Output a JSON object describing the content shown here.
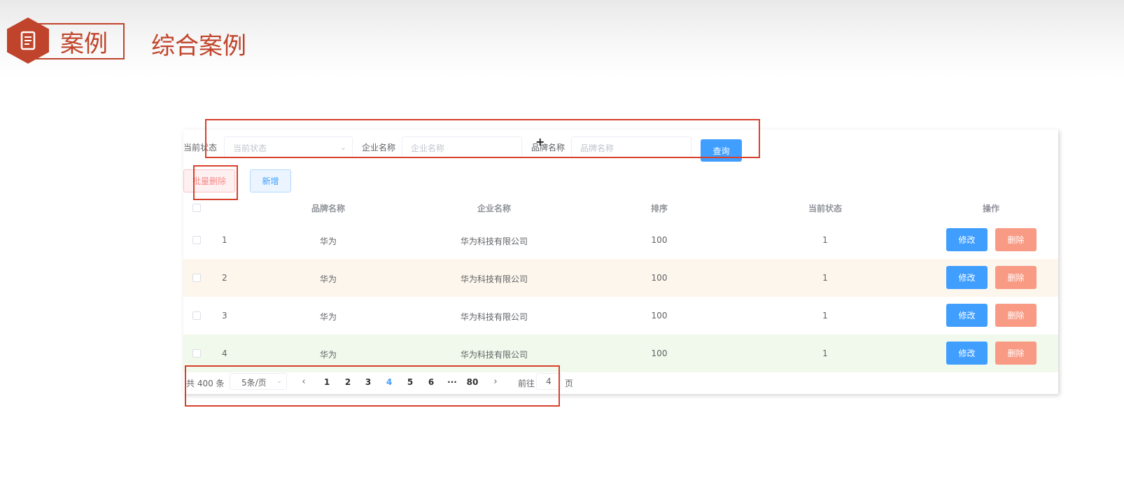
{
  "slide": {
    "badge": "案例",
    "subtitle": "综合案例",
    "accent_color": "#c0442b",
    "icon": "document-icon"
  },
  "search": {
    "status_label": "当前状态",
    "status_placeholder": "当前状态",
    "company_label": "企业名称",
    "company_placeholder": "企业名称",
    "brand_label": "品牌名称",
    "brand_placeholder": "品牌名称",
    "query_button": "查询"
  },
  "actions": {
    "batch_delete": "批量删除",
    "add": "新增"
  },
  "table": {
    "headers": {
      "brand": "品牌名称",
      "company": "企业名称",
      "order": "排序",
      "status": "当前状态",
      "ops": "操作"
    },
    "edit_label": "修改",
    "delete_label": "删除",
    "rows": [
      {
        "index": "1",
        "brand": "华为",
        "company": "华为科技有限公司",
        "order": "100",
        "status": "1",
        "highlight": ""
      },
      {
        "index": "2",
        "brand": "华为",
        "company": "华为科技有限公司",
        "order": "100",
        "status": "1",
        "highlight": "#fdf6ec"
      },
      {
        "index": "3",
        "brand": "华为",
        "company": "华为科技有限公司",
        "order": "100",
        "status": "1",
        "highlight": ""
      },
      {
        "index": "4",
        "brand": "华为",
        "company": "华为科技有限公司",
        "order": "100",
        "status": "1",
        "highlight": "#f0f9eb"
      }
    ]
  },
  "pagination": {
    "total": "共 400 条",
    "page_size": "5条/页",
    "pages": [
      "1",
      "2",
      "3",
      "4",
      "5",
      "6",
      "···",
      "80"
    ],
    "current": "4",
    "prev": "‹",
    "next": "›",
    "goto_label": "前往",
    "goto_value": "4",
    "page_suffix": "页"
  }
}
